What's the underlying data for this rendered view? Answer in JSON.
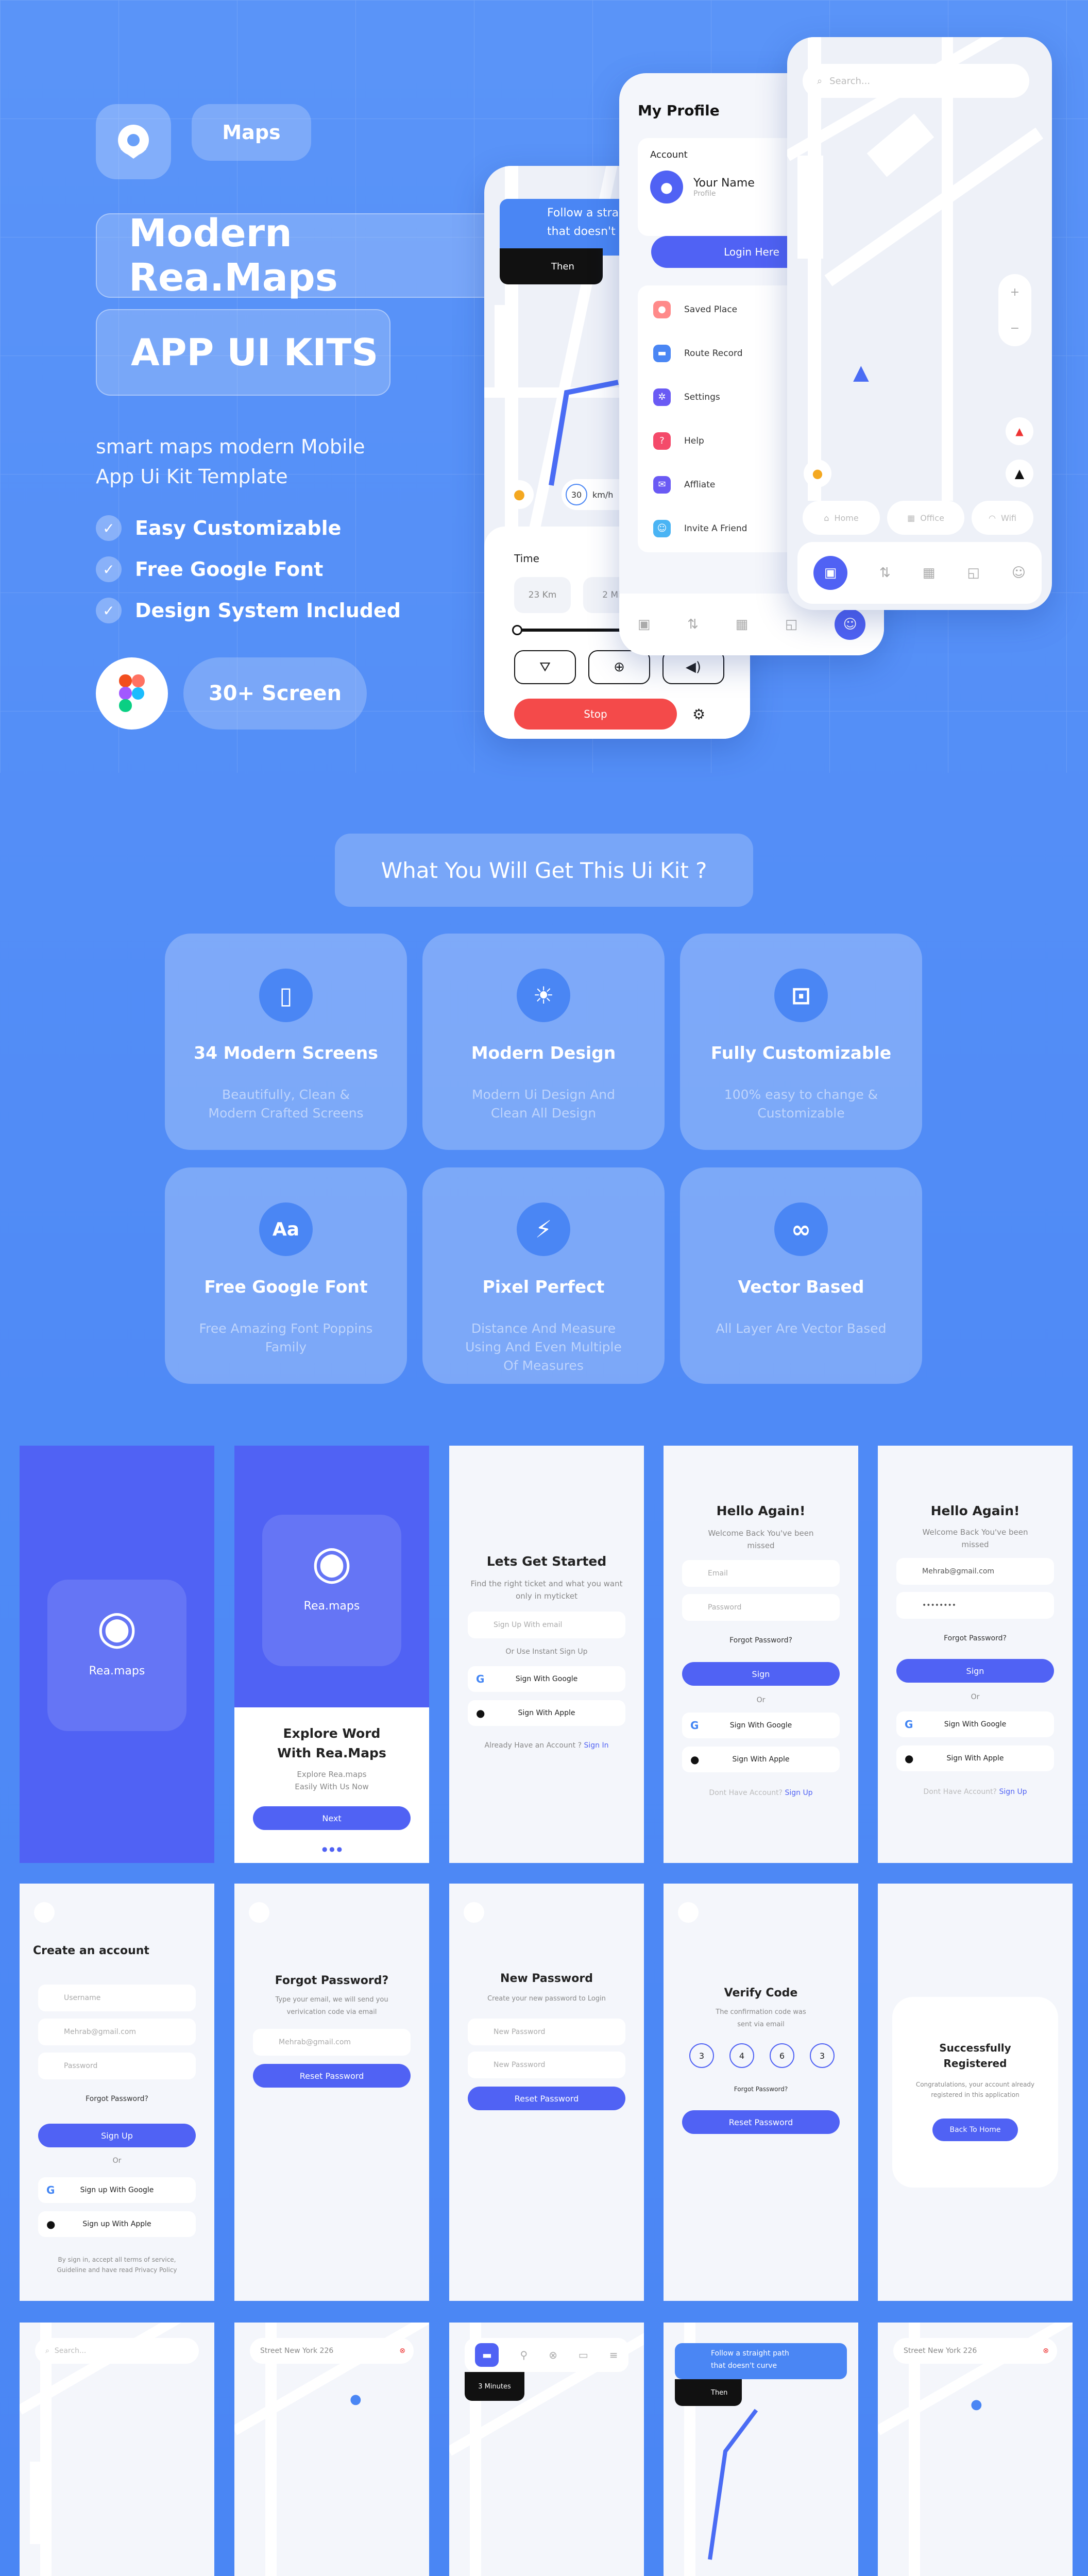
{
  "hero": {
    "tag": "Maps",
    "title": "Modern Rea.Maps",
    "subtitle": "APP UI KITS",
    "description_line1": "smart maps modern Mobile",
    "description_line2": "App Ui Kit Template",
    "features": [
      "Easy Customizable",
      "Free Google Font",
      "Design System Included"
    ],
    "screens_badge": "30+ Screen"
  },
  "preview": {
    "nav_text_1": "Follow a straig",
    "nav_text_2": "that doesn't",
    "then_label": "Then",
    "speed_value": "30",
    "speed_unit": "km/h",
    "time_label": "Time",
    "distance": "23 Km",
    "duration": "2 Mi",
    "stop_button": "Stop",
    "profile_title": "My Profile",
    "account_label": "Account",
    "user_name": "Your Name",
    "user_role": "Profile",
    "login_button": "Login Here",
    "menu": [
      "Saved Place",
      "Route Record",
      "Settings",
      "Help",
      "Affliate",
      "Invite A Friend"
    ],
    "search_placeholder": "Search...",
    "places": [
      "Home",
      "Office",
      "Wifi"
    ]
  },
  "whats_included": {
    "heading": "What You Will Get This Ui Kit ?",
    "cards": [
      {
        "icon": "A",
        "title": "34 Modern Screens",
        "desc": "Beautifully, Clean & Modern Crafted Screens"
      },
      {
        "icon": "☀",
        "title": "Modern Design",
        "desc": "Modern Ui Design And Clean All Design"
      },
      {
        "icon": "⊡",
        "title": "Fully Customizable",
        "desc": "100% easy to change & Customizable"
      },
      {
        "icon": "Aa",
        "title": "Free Google Font",
        "desc": "Free Amazing Font Poppins Family"
      },
      {
        "icon": "⚡",
        "title": "Pixel Perfect",
        "desc": "Distance And Measure Using And Even Multiple Of Measures"
      },
      {
        "icon": "∞",
        "title": "Vector Based",
        "desc": "All Layer Are Vector Based"
      }
    ]
  },
  "screens": {
    "brand": "Rea.maps",
    "brand2": "Rea.maps",
    "onboard_title": "Explore Word With Rea.Maps",
    "onboard_sub": "Explore Rea.maps Easily With Us Now",
    "next": "Next",
    "start_title": "Lets Get Started",
    "start_sub": "Find the right ticket and what you want only in myticket",
    "signup_email": "Sign Up With email",
    "instant": "Or Use Instant Sign Up",
    "google": "Sign With Google",
    "apple": "Sign With Apple",
    "have_account": "Already Have an Account ?",
    "sign_in": "Sign In",
    "hello": "Hello Again!",
    "hello_sub": "Welcome Back You've been missed",
    "email": "Email",
    "password": "Password",
    "email_filled": "Mehrab@gmail.com",
    "password_filled": "••••••••",
    "forgot": "Forgot Password?",
    "sign_btn": "Sign",
    "or": "Or",
    "no_account": "Dont Have Account?",
    "sign_up": "Sign Up",
    "create_title": "Create an account",
    "username": "Username",
    "signup_btn": "Sign Up",
    "signup_google": "Sign up With Google",
    "signup_apple": "Sign up With Apple",
    "terms": "By sign in, accept all terms of service, Guideline and have read Privacy Policy",
    "forgot_title": "Forgot Password?",
    "forgot_sub": "Type your email, we will send you verivication code via email",
    "reset_btn": "Reset Password",
    "new_pw_title": "New Password",
    "new_pw_sub": "Create your new password to Login",
    "new_password": "New Password",
    "verify_title": "Verify Code",
    "verify_sub": "The confirmation code was sent via email",
    "codes": [
      "3",
      "4",
      "6",
      "3"
    ],
    "success_title": "Successfully Registered",
    "success_sub": "Congratulations, your account already registered in this application",
    "back_home": "Back To Home",
    "search": "Search...",
    "street": "Street New York 226",
    "minutes": "3 Minutes",
    "follow1": "Follow a straight path",
    "follow2": "that doesn't curve",
    "then": "Then"
  }
}
